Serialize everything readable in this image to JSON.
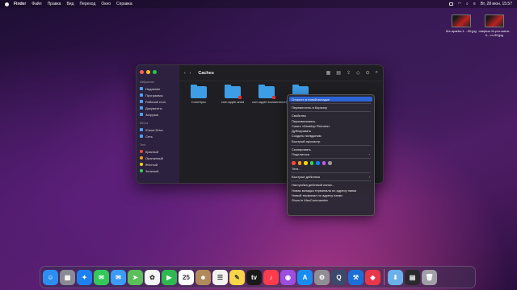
{
  "menubar": {
    "app": "Finder",
    "items": [
      "Файл",
      "Правка",
      "Вид",
      "Переход",
      "Окно",
      "Справка"
    ],
    "datetime": "Вт, 28 июн. 15:57"
  },
  "desktop_files": [
    {
      "name": "fire-sparks-1....90.jpg"
    },
    {
      "name": "oneplus-11-pro-warm-li....m-90.jpg"
    }
  ],
  "finder": {
    "title": "Caches",
    "sidebar": {
      "favorites_title": "Избранное",
      "favorites": [
        "Недавние",
        "Программы",
        "Рабочий стол",
        "Документы",
        "Загрузки"
      ],
      "places_title": "Места",
      "places": [
        "iCloud Drive",
        "Сеть"
      ],
      "tags_title": "Теги",
      "tags": [
        {
          "label": "Красный",
          "color": "#ff453a"
        },
        {
          "label": "Оранжевый",
          "color": "#ff9f0a"
        },
        {
          "label": "Желтый",
          "color": "#ffd60a"
        },
        {
          "label": "Зеленый",
          "color": "#32d74b"
        }
      ]
    },
    "files": [
      {
        "name": "ColorSync",
        "badge": false
      },
      {
        "name": "com.apple.aned",
        "badge": true
      },
      {
        "name": "com.apple.iconservices.store",
        "badge": true
      },
      {
        "name": "Desktop",
        "badge": false
      }
    ]
  },
  "context_menu": {
    "items": [
      {
        "label": "Открыть в новой вкладке",
        "highlighted": true
      },
      {
        "sep": true
      },
      {
        "label": "Переместить в Корзину"
      },
      {
        "sep": true
      },
      {
        "label": "Свойства"
      },
      {
        "label": "Переименовать"
      },
      {
        "label": "Сжать «Desktop Pictures»"
      },
      {
        "label": "Дублировать"
      },
      {
        "label": "Создать псевдоним"
      },
      {
        "label": "Быстрый просмотр"
      },
      {
        "sep": true
      },
      {
        "label": "Скопировать"
      },
      {
        "label": "Поделиться",
        "submenu": true
      },
      {
        "sep": true
      },
      {
        "colors": true
      },
      {
        "label": "Теги..."
      },
      {
        "sep": true
      },
      {
        "label": "Быстрые действия",
        "submenu": true
      },
      {
        "sep": true
      },
      {
        "label": "Настройка действий папки..."
      },
      {
        "label": "Новая вкладка терминала по адресу папки"
      },
      {
        "label": "Новый терминал по адресу папки"
      },
      {
        "label": "Show in MacCommander"
      }
    ],
    "tag_colors": [
      "#ff453a",
      "#ff9f0a",
      "#ffd60a",
      "#32d74b",
      "#0a84ff",
      "#bf5af2",
      "#98989d"
    ]
  },
  "dock": {
    "apps": [
      {
        "name": "finder-icon",
        "color": "#2d8ef0",
        "glyph": "☺"
      },
      {
        "name": "launchpad-icon",
        "color": "#8a8a94",
        "glyph": "▦"
      },
      {
        "name": "safari-icon",
        "color": "#1e7ff0",
        "glyph": "✦"
      },
      {
        "name": "messages-icon",
        "color": "#34c759",
        "glyph": "✉"
      },
      {
        "name": "mail-icon",
        "color": "#3b9bf5",
        "glyph": "✉"
      },
      {
        "name": "maps-icon",
        "color": "#5bbf5a",
        "glyph": "➤"
      },
      {
        "name": "photos-icon",
        "color": "#f4f4f4",
        "glyph": "✿"
      },
      {
        "name": "facetime-icon",
        "color": "#2fb84f",
        "glyph": "▶"
      },
      {
        "name": "calendar-icon",
        "color": "#ffffff",
        "glyph": "25"
      },
      {
        "name": "contacts-icon",
        "color": "#b08a5a",
        "glyph": "☻"
      },
      {
        "name": "reminders-icon",
        "color": "#f2f2f2",
        "glyph": "☰"
      },
      {
        "name": "notes-icon",
        "color": "#f7d548",
        "glyph": "✎"
      },
      {
        "name": "tv-icon",
        "color": "#1a1a1a",
        "glyph": "tv"
      },
      {
        "name": "music-icon",
        "color": "#fa3c4c",
        "glyph": "♪"
      },
      {
        "name": "podcasts-icon",
        "color": "#9b4ee0",
        "glyph": "◉"
      },
      {
        "name": "appstore-icon",
        "color": "#1a8cf0",
        "glyph": "A"
      },
      {
        "name": "settings-icon",
        "color": "#8e8e93",
        "glyph": "⚙"
      },
      {
        "name": "quicktime-icon",
        "color": "#3a4a6a",
        "glyph": "Q"
      },
      {
        "name": "xcode-icon",
        "color": "#1c6fd8",
        "glyph": "⚒"
      },
      {
        "name": "pocket-icon",
        "color": "#e8374a",
        "glyph": "◆"
      }
    ],
    "right": [
      {
        "name": "downloads-folder-icon",
        "color": "#6ab0ea",
        "glyph": "⬇"
      },
      {
        "name": "window-thumbnail-icon",
        "color": "#2a2a2e",
        "glyph": "▤"
      },
      {
        "name": "trash-icon",
        "color": "#a0a0a8",
        "glyph": "🗑"
      }
    ]
  }
}
